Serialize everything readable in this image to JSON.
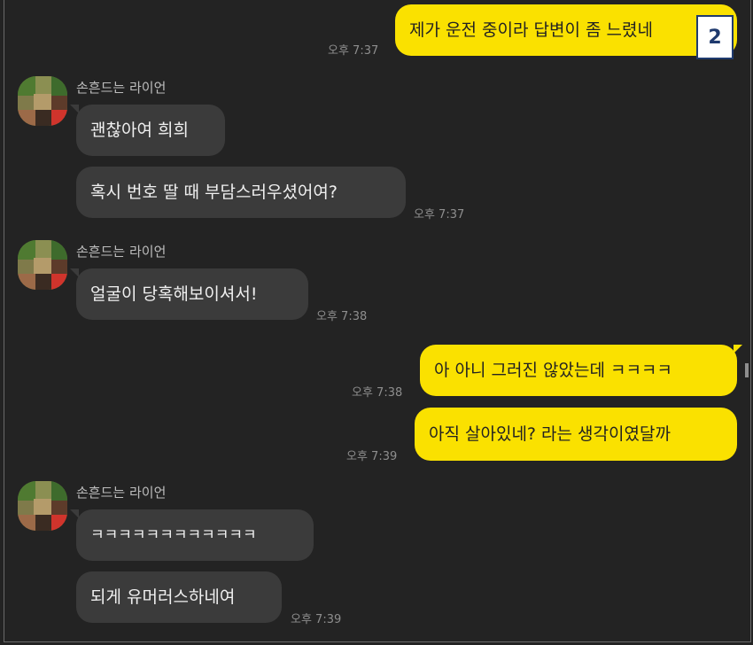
{
  "colors": {
    "background": "#232323",
    "incoming_bubble": "#3b3b3b",
    "outgoing_bubble": "#fae100",
    "time_text": "#8e8e8e"
  },
  "badge": "2",
  "messages": [
    {
      "text": "제가 운전 중이라 답변이 좀 느렸네",
      "time": "오후 7:37"
    },
    {
      "sender": "손흔드는 라이언",
      "text": "괜찮아여 희희"
    },
    {
      "text": "혹시 번호 딸 때 부담스러우셨어여?",
      "time": "오후 7:37"
    },
    {
      "sender": "손흔드는 라이언",
      "text": "얼굴이 당혹해보이셔서!",
      "time": "오후 7:38"
    },
    {
      "text": "아 아니 그러진 않았는데 ㅋㅋㅋㅋ",
      "time": "오후 7:38"
    },
    {
      "text": "아직 살아있네? 라는 생각이였달까",
      "time": "오후 7:39"
    },
    {
      "sender": "손흔드는 라이언",
      "text": "ㅋㅋㅋㅋㅋㅋㅋㅋㅋㅋㅋㅋ"
    },
    {
      "text": "되게 유머러스하네여",
      "time": "오후 7:39"
    }
  ]
}
